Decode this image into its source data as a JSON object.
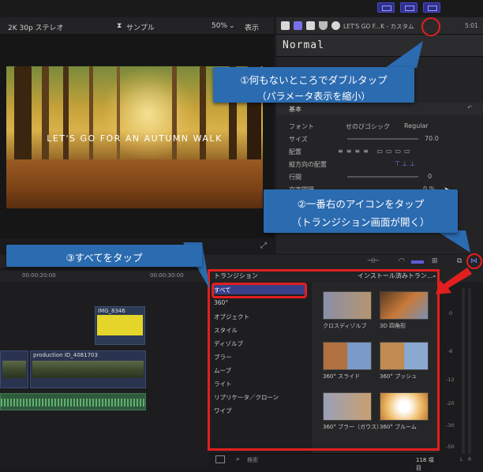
{
  "viewer": {
    "format": "2K 30p ステレオ",
    "clip_name": "サンプル",
    "zoom": "50%",
    "view_menu": "表示",
    "video_title": "LET'S GO FOR AN AUTUMN WALK"
  },
  "inspector": {
    "title": "LET'S GO F...K - カスタム",
    "timecode": "5:01",
    "preset": "Normal",
    "section_basic": "基本",
    "rows": [
      {
        "label": "フォント",
        "value": "せのびゴシック",
        "value2": "Regular"
      },
      {
        "label": "サイズ",
        "value": "70.0"
      },
      {
        "label": "配置",
        "value": ""
      },
      {
        "label": "縦方向の配置",
        "value": ""
      },
      {
        "label": "行間",
        "value": "0"
      },
      {
        "label": "文字間隔",
        "value": "0 %"
      }
    ]
  },
  "timeline": {
    "ruler": [
      "00:00:20:00",
      "00:00:30:00"
    ],
    "clip_top": "IMG_8346",
    "clip_main": "production ID_4081703"
  },
  "transitions": {
    "header": "トランジション",
    "source_menu": "インストール済みトラン...",
    "categories": [
      "すべて",
      "360°",
      "オブジェクト",
      "スタイル",
      "ディゾルブ",
      "ブラー",
      "ムーブ",
      "ライト",
      "リプリケータ／クローン",
      "ワイプ"
    ],
    "items": [
      "クロスディゾルブ",
      "3D 四角形",
      "360° スライド",
      "360° プッシュ",
      "360° ブラー（ガウス）",
      "360° ブルーム"
    ],
    "search_placeholder": "検索",
    "count": "118 項目"
  },
  "meter": {
    "ticks": [
      "0",
      "-6",
      "-12",
      "-20",
      "-30",
      "-50"
    ],
    "channels": [
      "L",
      "R"
    ]
  },
  "callouts": {
    "c1_line1": "①何もないところでダブルタップ",
    "c1_line2": "（パラメータ表示を縮小）",
    "c2_line1": "②一番右のアイコンをタップ",
    "c2_line2": "（トランジション画面が開く）",
    "c3": "③すべてをタップ"
  },
  "colors": {
    "callout": "#2b6bb0",
    "highlight_red": "#e21f1f",
    "selected_category": "#3a3f8a"
  }
}
